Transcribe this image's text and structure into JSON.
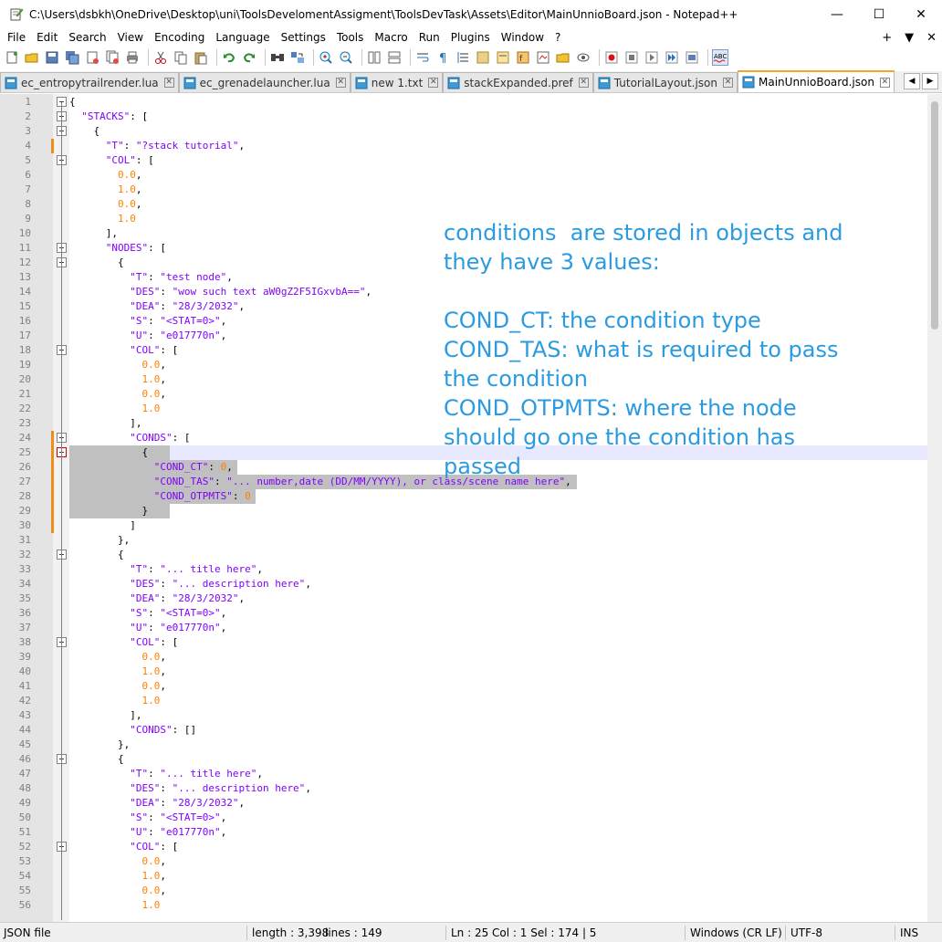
{
  "window": {
    "title": "C:\\Users\\dsbkh\\OneDrive\\Desktop\\uni\\ToolsDevelomentAssigment\\ToolsDevTask\\Assets\\Editor\\MainUnnioBoard.json - Notepad++",
    "minimize": "—",
    "maximize": "☐",
    "close": "✕"
  },
  "menu": {
    "items": [
      "File",
      "Edit",
      "Search",
      "View",
      "Encoding",
      "Language",
      "Settings",
      "Tools",
      "Macro",
      "Run",
      "Plugins",
      "Window",
      "?"
    ],
    "right": [
      "+",
      "▼",
      "✕"
    ]
  },
  "toolbar": {
    "icons": [
      "new-file-icon",
      "open-file-icon",
      "save-icon",
      "save-all-icon",
      "close-icon",
      "close-all-icon",
      "print-icon",
      "cut-icon",
      "copy-icon",
      "paste-icon",
      "undo-icon",
      "redo-icon",
      "find-icon",
      "replace-icon",
      "zoom-in-icon",
      "zoom-out-icon",
      "sync-vertical-icon",
      "sync-horizontal-icon",
      "word-wrap-icon",
      "show-all-chars-icon",
      "indent-guide-icon",
      "language-icon",
      "doc-map-icon",
      "function-list-icon",
      "folder-workspace-icon",
      "monitoring-icon",
      "record-macro-icon",
      "stop-record-icon",
      "play-macro-icon",
      "run-macro-multiple-icon",
      "save-macro-icon",
      "spell-check-icon"
    ]
  },
  "tabs": [
    {
      "label": "ec_entropytrailrender.lua",
      "active": false
    },
    {
      "label": "ec_grenadelauncher.lua",
      "active": false
    },
    {
      "label": "new 1.txt",
      "active": false
    },
    {
      "label": "stackExpanded.pref",
      "active": false
    },
    {
      "label": "TutorialLayout.json",
      "active": false
    },
    {
      "label": "MainUnnioBoard.json",
      "active": true
    }
  ],
  "annotation": {
    "text": "conditions  are stored in objects and\nthey have 3 values:\n\nCOND_CT: the condition type\nCOND_TAS: what is required to pass\nthe condition\nCOND_OTPMTS: where the node\nshould go one the condition has\npassed"
  },
  "editor": {
    "lines": [
      {
        "n": "1",
        "t": "{"
      },
      {
        "n": "2",
        "t": "  \"STACKS\": ["
      },
      {
        "n": "3",
        "t": "    {"
      },
      {
        "n": "4",
        "t": "      \"T\": \"?stack tutorial\","
      },
      {
        "n": "5",
        "t": "      \"COL\": ["
      },
      {
        "n": "6",
        "t": "        0.0,"
      },
      {
        "n": "7",
        "t": "        1.0,"
      },
      {
        "n": "8",
        "t": "        0.0,"
      },
      {
        "n": "9",
        "t": "        1.0"
      },
      {
        "n": "10",
        "t": "      ],"
      },
      {
        "n": "11",
        "t": "      \"NODES\": ["
      },
      {
        "n": "12",
        "t": "        {"
      },
      {
        "n": "13",
        "t": "          \"T\": \"test node\","
      },
      {
        "n": "14",
        "t": "          \"DES\": \"wow such text aW0gZ2F5IGxvbA==\","
      },
      {
        "n": "15",
        "t": "          \"DEA\": \"28/3/2032\","
      },
      {
        "n": "16",
        "t": "          \"S\": \"<STAT=0>\","
      },
      {
        "n": "17",
        "t": "          \"U\": \"e017770n\","
      },
      {
        "n": "18",
        "t": "          \"COL\": ["
      },
      {
        "n": "19",
        "t": "            0.0,"
      },
      {
        "n": "20",
        "t": "            1.0,"
      },
      {
        "n": "21",
        "t": "            0.0,"
      },
      {
        "n": "22",
        "t": "            1.0"
      },
      {
        "n": "23",
        "t": "          ],"
      },
      {
        "n": "24",
        "t": "          \"CONDS\": ["
      },
      {
        "n": "25",
        "t": "            {"
      },
      {
        "n": "26",
        "t": "              \"COND_CT\": 0,"
      },
      {
        "n": "27",
        "t": "              \"COND_TAS\": \"... number,date (DD/MM/YYYY), or class/scene name here\","
      },
      {
        "n": "28",
        "t": "              \"COND_OTPMTS\": 0"
      },
      {
        "n": "29",
        "t": "            }"
      },
      {
        "n": "30",
        "t": "          ]"
      },
      {
        "n": "31",
        "t": "        },"
      },
      {
        "n": "32",
        "t": "        {"
      },
      {
        "n": "33",
        "t": "          \"T\": \"... title here\","
      },
      {
        "n": "34",
        "t": "          \"DES\": \"... description here\","
      },
      {
        "n": "35",
        "t": "          \"DEA\": \"28/3/2032\","
      },
      {
        "n": "36",
        "t": "          \"S\": \"<STAT=0>\","
      },
      {
        "n": "37",
        "t": "          \"U\": \"e017770n\","
      },
      {
        "n": "38",
        "t": "          \"COL\": ["
      },
      {
        "n": "39",
        "t": "            0.0,"
      },
      {
        "n": "40",
        "t": "            1.0,"
      },
      {
        "n": "41",
        "t": "            0.0,"
      },
      {
        "n": "42",
        "t": "            1.0"
      },
      {
        "n": "43",
        "t": "          ],"
      },
      {
        "n": "44",
        "t": "          \"CONDS\": []"
      },
      {
        "n": "45",
        "t": "        },"
      },
      {
        "n": "46",
        "t": "        {"
      },
      {
        "n": "47",
        "t": "          \"T\": \"... title here\","
      },
      {
        "n": "48",
        "t": "          \"DES\": \"... description here\","
      },
      {
        "n": "49",
        "t": "          \"DEA\": \"28/3/2032\","
      },
      {
        "n": "50",
        "t": "          \"S\": \"<STAT=0>\","
      },
      {
        "n": "51",
        "t": "          \"U\": \"e017770n\","
      },
      {
        "n": "52",
        "t": "          \"COL\": ["
      },
      {
        "n": "53",
        "t": "            0.0,"
      },
      {
        "n": "54",
        "t": "            1.0,"
      },
      {
        "n": "55",
        "t": "            0.0,"
      },
      {
        "n": "56",
        "t": "            1.0"
      }
    ],
    "current_line": "25",
    "selected_lines": [
      "25",
      "26",
      "27",
      "28",
      "29"
    ],
    "fold_lines": [
      "1",
      "2",
      "3",
      "5",
      "11",
      "12",
      "18",
      "24",
      "25",
      "32",
      "38",
      "46",
      "52"
    ]
  },
  "status": {
    "file_type": "JSON file",
    "length": "length : 3,398",
    "lines": "lines : 149",
    "position": "Ln : 25    Col : 1    Sel : 174 | 5",
    "eol": "Windows (CR LF)",
    "encoding": "UTF-8",
    "mode": "INS"
  },
  "colors": {
    "accent_tab": "#f5a623",
    "annotation": "#2b9be0",
    "json_string": "#8000ff",
    "json_number": "#ff8000",
    "selection": "#c0c0c0",
    "current_line": "#e8e8ff",
    "change_marker": "#f08c1a"
  }
}
